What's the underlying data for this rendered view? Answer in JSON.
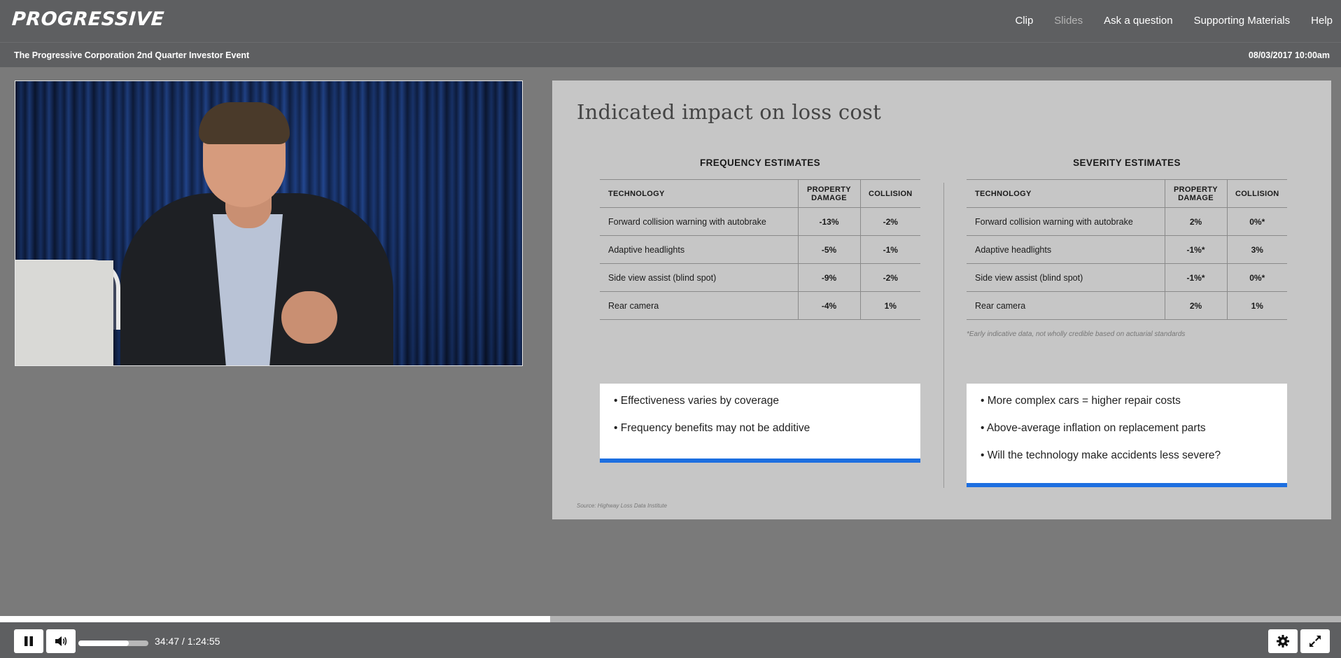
{
  "header": {
    "logo_text": "PROGRESSIVE",
    "nav": [
      {
        "label": "Clip",
        "active": false
      },
      {
        "label": "Slides",
        "active": true
      },
      {
        "label": "Ask a question",
        "active": false
      },
      {
        "label": "Supporting Materials",
        "active": false
      },
      {
        "label": "Help",
        "active": false
      }
    ]
  },
  "event": {
    "title": "The Progressive Corporation 2nd Quarter Investor Event",
    "date": "08/03/2017 10:00am"
  },
  "slide": {
    "title": "Indicated impact on loss cost",
    "frequency": {
      "heading": "FREQUENCY ESTIMATES",
      "columns": [
        "TECHNOLOGY",
        "PROPERTY DAMAGE",
        "COLLISION"
      ],
      "rows": [
        [
          "Forward collision warning with autobrake",
          "-13%",
          "-2%"
        ],
        [
          "Adaptive headlights",
          "-5%",
          "-1%"
        ],
        [
          "Side view assist (blind spot)",
          "-9%",
          "-2%"
        ],
        [
          "Rear camera",
          "-4%",
          "1%"
        ]
      ],
      "bullets": [
        "• Effectiveness varies by coverage",
        "• Frequency benefits may not be additive"
      ]
    },
    "severity": {
      "heading": "SEVERITY ESTIMATES",
      "columns": [
        "TECHNOLOGY",
        "PROPERTY DAMAGE",
        "COLLISION"
      ],
      "rows": [
        [
          "Forward collision warning with autobrake",
          "2%",
          "0%*"
        ],
        [
          "Adaptive headlights",
          "-1%*",
          "3%"
        ],
        [
          "Side view assist (blind spot)",
          "-1%*",
          "0%*"
        ],
        [
          "Rear camera",
          "2%",
          "1%"
        ]
      ],
      "footnote": "*Early indicative data, not wholly credible based on actuarial standards",
      "bullets": [
        "• More complex cars = higher repair costs",
        "• Above-average inflation on replacement parts",
        "• Will the technology make accidents less severe?"
      ]
    },
    "source": "Source: Highway Loss Data Institute",
    "accent_color": "#1d6fe0"
  },
  "player": {
    "time_display": "34:47 / 1:24:55",
    "progress_fraction": 0.41,
    "volume_fraction": 0.72,
    "icons": {
      "play_pause": "pause-icon",
      "volume": "volume-icon",
      "settings": "gear-icon",
      "fullscreen": "fullscreen-icon"
    }
  }
}
